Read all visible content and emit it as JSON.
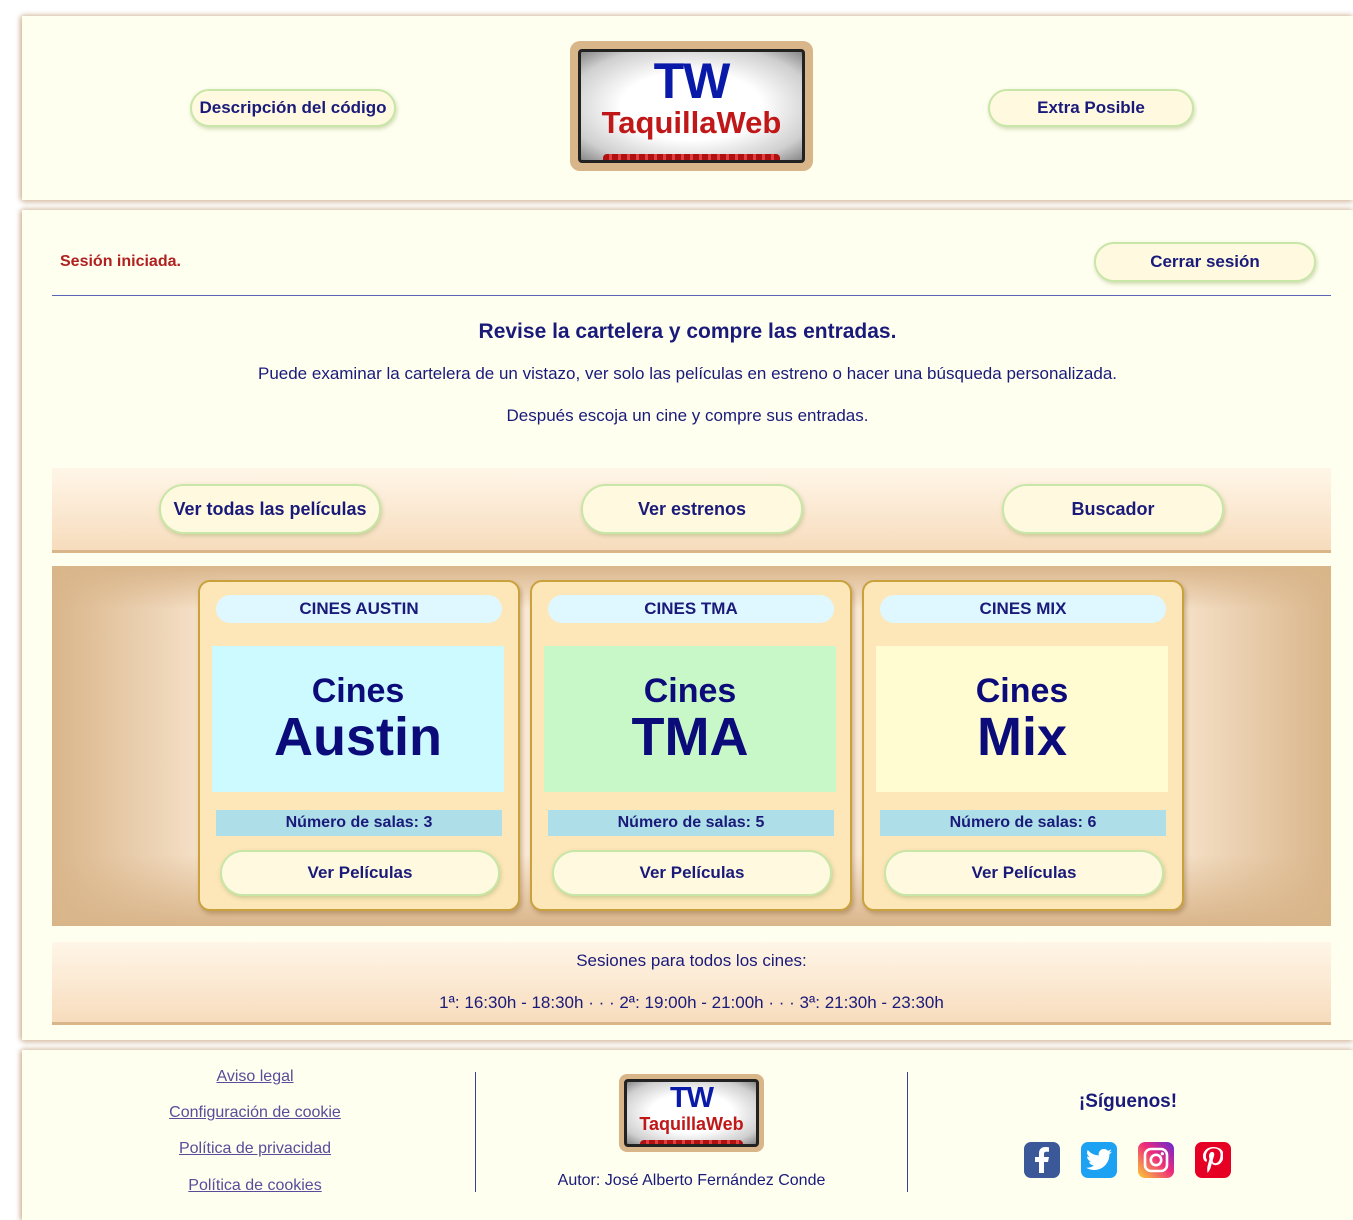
{
  "header": {
    "btn_descripcion": "Descripción del código",
    "btn_extra": "Extra Posible",
    "logo": {
      "tw": "TW",
      "name": "TaquillaWeb"
    }
  },
  "session": {
    "status": "Sesión iniciada.",
    "logout": "Cerrar sesión"
  },
  "intro": {
    "heading": "Revise la cartelera y compre las entradas.",
    "line1": "Puede examinar la cartelera de un vistazo, ver solo las películas en estreno o hacer una búsqueda personalizada.",
    "line2": "Después escoja un cine y compre sus entradas."
  },
  "actions": {
    "all": "Ver todas las películas",
    "estrenos": "Ver estrenos",
    "buscador": "Buscador"
  },
  "cines": [
    {
      "title": "CINES AUSTIN",
      "img_l1": "Cines",
      "img_l2": "Austin",
      "salas": "Número de salas: 3",
      "button": "Ver Películas",
      "bg": "#ccfaff"
    },
    {
      "title": "CINES TMA",
      "img_l1": "Cines",
      "img_l2": "TMA",
      "salas": "Número de salas: 5",
      "button": "Ver Películas",
      "bg": "#c8f7c8"
    },
    {
      "title": "CINES MIX",
      "img_l1": "Cines",
      "img_l2": "Mix",
      "salas": "Número de salas: 6",
      "button": "Ver Películas",
      "bg": "#fffcd2"
    }
  ],
  "sesiones": {
    "label": "Sesiones para todos los cines:",
    "times": "1ª: 16:30h - 18:30h · · · 2ª: 19:00h - 21:00h · · · 3ª: 21:30h - 23:30h"
  },
  "footer": {
    "links": [
      "Aviso legal",
      "Configuración de cookie",
      "Política de privacidad",
      "Política de cookies"
    ],
    "logo": {
      "tw": "TW",
      "name": "TaquillaWeb"
    },
    "author": "Autor: José Alberto Fernández Conde",
    "follow": "¡Síguenos!",
    "social": [
      {
        "icon": "facebook-icon",
        "color": "#3b5998"
      },
      {
        "icon": "twitter-icon",
        "color": "#1da1f2"
      },
      {
        "icon": "instagram-icon",
        "color": "#d6249f"
      },
      {
        "icon": "pinterest-icon",
        "color": "#e60023"
      }
    ]
  }
}
